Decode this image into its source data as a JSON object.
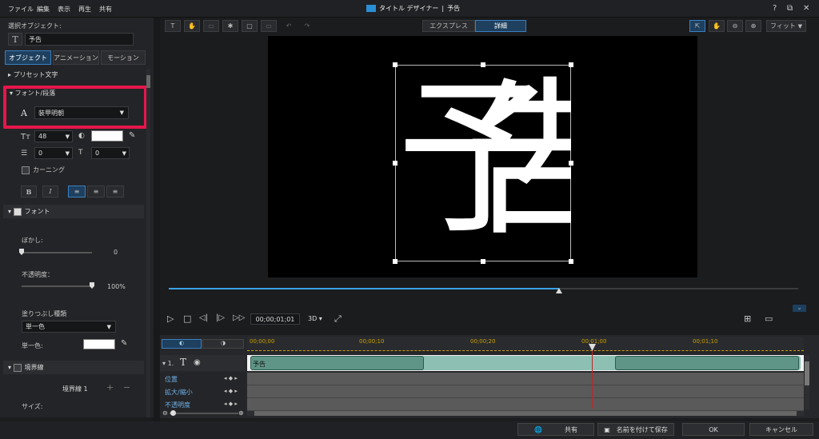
{
  "menu": {
    "file": "ファイル",
    "edit": "編集",
    "view": "表示",
    "play": "再生",
    "share": "共有"
  },
  "window": {
    "app_title": "タイトル デザイナー",
    "sep": "|",
    "doc_title": "予告",
    "help": "?"
  },
  "left": {
    "selected_label": "選択オブジェクト:",
    "selected_value": "予告",
    "tabs": {
      "object": "オブジェクト",
      "animation": "アニメーション",
      "motion": "モーション"
    },
    "preset": "プリセット文字",
    "font_para": "フォント/段落",
    "font_name": "装甲明朝",
    "font_size": "48",
    "line_spacing": "0",
    "char_spacing": "0",
    "kerning": "カーニング",
    "bold": "B",
    "italic": "I",
    "font_section": "フォント",
    "blur_label": "ぼかし:",
    "blur_value": "0",
    "blur_level": 0,
    "opacity_label": "不透明度：",
    "opacity_value": "100%",
    "opacity_level": 1.0,
    "fill_type_label": "塗りつぶし種類",
    "fill_type_value": "単一色",
    "single_color_label": "単一色:",
    "border_section": "境界線",
    "border1": "境界線 1",
    "size_label": "サイズ:"
  },
  "toolbar": {
    "express": "エクスプレス",
    "detail": "詳細",
    "fit": "フィット"
  },
  "canvas": {
    "text": "予告",
    "progress": 0.62
  },
  "player": {
    "timecode": "00;00;01;01",
    "mode3d": "3D"
  },
  "timeline": {
    "ticks": [
      "00;00;00",
      "00;00;10",
      "00;00;20",
      "00;01;00",
      "00;01;10"
    ],
    "track_index": "1.",
    "clip_label": "予告",
    "props": [
      "位置",
      "拡大/縮小",
      "不透明度"
    ]
  },
  "bottom": {
    "share": "共有",
    "save_as": "名前を付けて保存",
    "ok": "OK",
    "cancel": "キャンセル"
  },
  "colors": {
    "accent": "#3aa3e8",
    "highlight": "#e6164b",
    "clip": "#6aa397",
    "playhead": "#c0262b"
  }
}
